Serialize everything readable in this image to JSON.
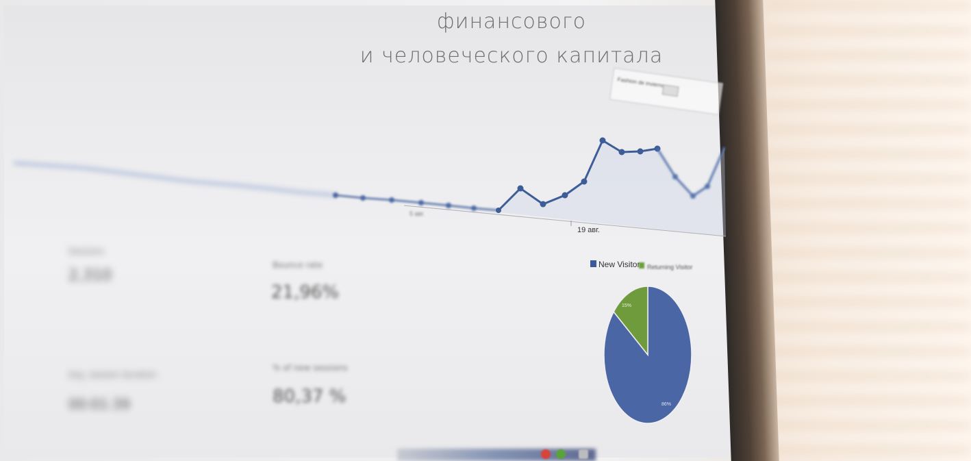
{
  "headline": {
    "line1": "финансового",
    "line2": "и человеческого капитала"
  },
  "screen": {
    "line_chart": {
      "date_label": "19 авг.",
      "date_label_faint": "5 авг."
    },
    "pie_chart": {
      "legend": [
        {
          "label": "New Visitor",
          "color": "#3b5a9a"
        },
        {
          "label": "Returning Visitor",
          "color": "#6aa03c"
        }
      ],
      "slices": [
        {
          "name": "New Visitor",
          "percent": 85.8,
          "color": "#4a66a5"
        },
        {
          "name": "Returning Visitor",
          "percent": 14.2,
          "color": "#6f9b3c"
        }
      ],
      "slice_labels": [
        "15%",
        "86%"
      ]
    },
    "stats": {
      "stat1_label": "Bounce rate",
      "stat1_value": "21,96%",
      "stat2_label": "% of new sessions",
      "stat2_value": "80,37 %",
      "left1_label": "Sessions",
      "left1_value": "2,310",
      "left2_label": "Avg. session duration",
      "left2_value": "00:01:39"
    },
    "toolbar_label": "Fashion de invierno"
  },
  "colors": {
    "line": "#3c5d98",
    "pie_blue": "#4a66a5",
    "pie_green": "#6f9b3c",
    "headline": "#6e6e70"
  }
}
